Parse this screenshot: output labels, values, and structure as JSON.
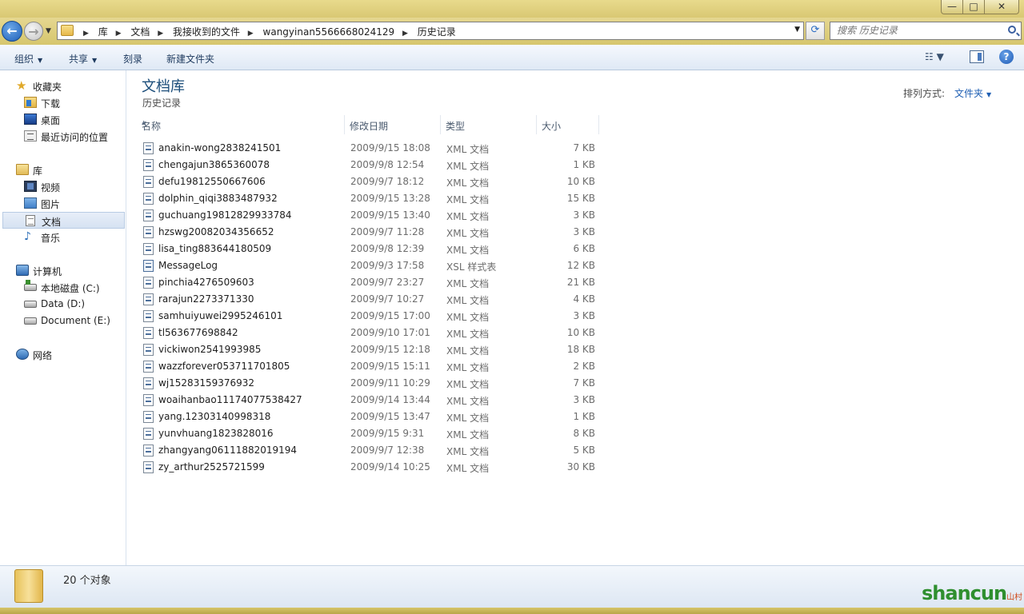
{
  "window": {
    "title": "",
    "controls": {
      "minimize": "—",
      "maximize": "□",
      "close": "✕"
    }
  },
  "address": {
    "crumbs": [
      "库",
      "文档",
      "我接收到的文件",
      "wangyinan5566668024129",
      "历史记录"
    ],
    "search_placeholder": "搜索 历史记录"
  },
  "commands": {
    "organize": "组织",
    "share": "共享",
    "burn": "刻录",
    "new_folder": "新建文件夹"
  },
  "nav": {
    "favorites": {
      "label": "收藏夹",
      "items": [
        "下载",
        "桌面",
        "最近访问的位置"
      ]
    },
    "libraries": {
      "label": "库",
      "items": [
        "视频",
        "图片",
        "文档",
        "音乐"
      ],
      "selected": "文档"
    },
    "computer": {
      "label": "计算机",
      "items": [
        "本地磁盘 (C:)",
        "Data (D:)",
        "Document (E:)"
      ]
    },
    "network": {
      "label": "网络"
    }
  },
  "library": {
    "title": "文档库",
    "subtitle": "历史记录",
    "arrange_label": "排列方式:",
    "arrange_value": "文件夹"
  },
  "columns": {
    "name": "名称",
    "date": "修改日期",
    "type": "类型",
    "size": "大小"
  },
  "files": [
    {
      "name": "anakin-wong2838241501",
      "date": "2009/9/15 18:08",
      "type": "XML 文档",
      "size": "7 KB",
      "icon": "xml-file-icon"
    },
    {
      "name": "chengajun3865360078",
      "date": "2009/9/8 12:54",
      "type": "XML 文档",
      "size": "1 KB",
      "icon": "xml-file-icon"
    },
    {
      "name": "defu19812550667606",
      "date": "2009/9/7 18:12",
      "type": "XML 文档",
      "size": "10 KB",
      "icon": "xml-file-icon"
    },
    {
      "name": "dolphin_qiqi3883487932",
      "date": "2009/9/15 13:28",
      "type": "XML 文档",
      "size": "15 KB",
      "icon": "xml-file-icon"
    },
    {
      "name": "guchuang19812829933784",
      "date": "2009/9/15 13:40",
      "type": "XML 文档",
      "size": "3 KB",
      "icon": "xml-file-icon"
    },
    {
      "name": "hzswg20082034356652",
      "date": "2009/9/7 11:28",
      "type": "XML 文档",
      "size": "3 KB",
      "icon": "xml-file-icon"
    },
    {
      "name": "lisa_ting883644180509",
      "date": "2009/9/8 12:39",
      "type": "XML 文档",
      "size": "6 KB",
      "icon": "xml-file-icon"
    },
    {
      "name": "MessageLog",
      "date": "2009/9/3 17:58",
      "type": "XSL 样式表",
      "size": "12 KB",
      "icon": "xsl-file-icon"
    },
    {
      "name": "pinchia4276509603",
      "date": "2009/9/7 23:27",
      "type": "XML 文档",
      "size": "21 KB",
      "icon": "xml-file-icon"
    },
    {
      "name": "rarajun2273371330",
      "date": "2009/9/7 10:27",
      "type": "XML 文档",
      "size": "4 KB",
      "icon": "xml-file-icon"
    },
    {
      "name": "samhuiyuwei2995246101",
      "date": "2009/9/15 17:00",
      "type": "XML 文档",
      "size": "3 KB",
      "icon": "xml-file-icon"
    },
    {
      "name": "tl563677698842",
      "date": "2009/9/10 17:01",
      "type": "XML 文档",
      "size": "10 KB",
      "icon": "xml-file-icon"
    },
    {
      "name": "vickiwon2541993985",
      "date": "2009/9/15 12:18",
      "type": "XML 文档",
      "size": "18 KB",
      "icon": "xml-file-icon"
    },
    {
      "name": "wazzforever053711701805",
      "date": "2009/9/15 15:11",
      "type": "XML 文档",
      "size": "2 KB",
      "icon": "xml-file-icon"
    },
    {
      "name": "wj15283159376932",
      "date": "2009/9/11 10:29",
      "type": "XML 文档",
      "size": "7 KB",
      "icon": "xml-file-icon"
    },
    {
      "name": "woaihanbao11174077538427",
      "date": "2009/9/14 13:44",
      "type": "XML 文档",
      "size": "3 KB",
      "icon": "xml-file-icon"
    },
    {
      "name": "yang.12303140998318",
      "date": "2009/9/15 13:47",
      "type": "XML 文档",
      "size": "1 KB",
      "icon": "xml-file-icon"
    },
    {
      "name": "yunvhuang1823828016",
      "date": "2009/9/15 9:31",
      "type": "XML 文档",
      "size": "8 KB",
      "icon": "xml-file-icon"
    },
    {
      "name": "zhangyang06111882019194",
      "date": "2009/9/7 12:38",
      "type": "XML 文档",
      "size": "5 KB",
      "icon": "xml-file-icon"
    },
    {
      "name": "zy_arthur2525721599",
      "date": "2009/9/14 10:25",
      "type": "XML 文档",
      "size": "30 KB",
      "icon": "xml-file-icon"
    }
  ],
  "details": {
    "count_text": "20 个对象"
  },
  "watermark": {
    "main": "shancun",
    "sub": "山村网 .net"
  },
  "colors": {
    "titlebar": "#d9c873",
    "accent": "#1f5fb3",
    "selection": "#d6e2f2"
  }
}
